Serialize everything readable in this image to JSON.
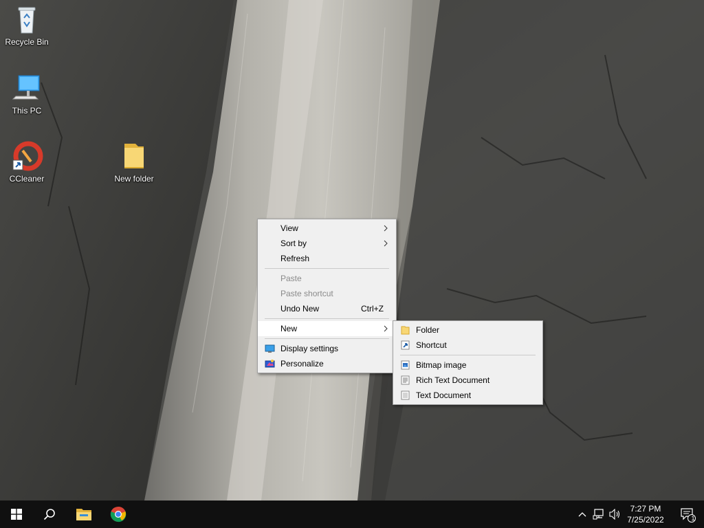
{
  "desktop": {
    "icons": [
      {
        "label": "Recycle Bin",
        "icon": "recycle-bin-icon"
      },
      {
        "label": "This PC",
        "icon": "computer-icon"
      },
      {
        "label": "CCleaner",
        "icon": "ccleaner-icon"
      },
      {
        "label": "New folder",
        "icon": "folder-icon"
      }
    ]
  },
  "context_menu": {
    "items": [
      {
        "label": "View",
        "submenu": true
      },
      {
        "label": "Sort by",
        "submenu": true
      },
      {
        "label": "Refresh"
      },
      {
        "label": "Paste",
        "disabled": true
      },
      {
        "label": "Paste shortcut",
        "disabled": true
      },
      {
        "label": "Undo New",
        "accelerator": "Ctrl+Z"
      },
      {
        "label": "New",
        "submenu": true,
        "highlighted": true
      },
      {
        "label": "Display settings",
        "icon": "display-settings-icon"
      },
      {
        "label": "Personalize",
        "icon": "personalize-icon"
      }
    ]
  },
  "new_submenu": {
    "items": [
      {
        "label": "Folder",
        "icon": "folder-icon"
      },
      {
        "label": "Shortcut",
        "icon": "shortcut-icon"
      },
      {
        "label": "Bitmap image",
        "icon": "bitmap-icon"
      },
      {
        "label": "Rich Text Document",
        "icon": "rich-text-document-icon"
      },
      {
        "label": "Text Document",
        "icon": "text-document-icon"
      }
    ]
  },
  "taskbar": {
    "pinned": [
      {
        "icon": "windows-start-icon"
      },
      {
        "icon": "search-icon"
      },
      {
        "icon": "file-explorer-icon"
      },
      {
        "icon": "chrome-icon"
      }
    ],
    "tray": {
      "icons": [
        "chevron-up-icon",
        "network-icon",
        "volume-icon"
      ],
      "time": "7:27 PM",
      "date": "7/25/2022",
      "notification_count": "1"
    }
  },
  "colors": {
    "menu_bg": "#f0f0f0",
    "menu_highlight": "#ffffff",
    "taskbar_bg": "#101010",
    "folder_yellow": "#f8d775"
  }
}
